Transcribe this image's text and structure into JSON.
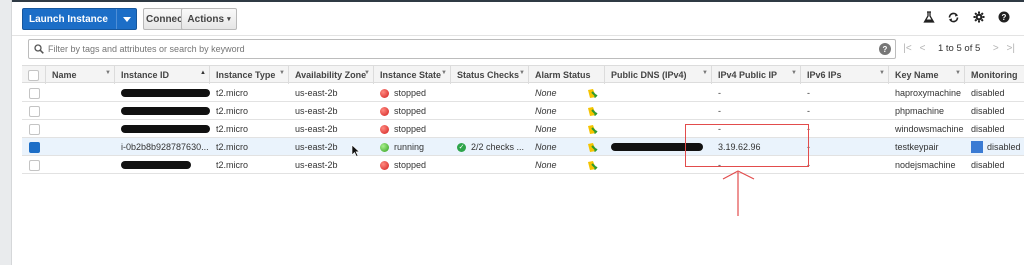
{
  "toolbar": {
    "launch_label": "Launch Instance",
    "connect_label": "Connect",
    "actions_label": "Actions",
    "icons": [
      "flask-icon",
      "refresh-icon",
      "gear-icon",
      "help-icon"
    ]
  },
  "search": {
    "placeholder": "Filter by tags and attributes or search by keyword",
    "help": "?"
  },
  "pager": {
    "first": "|<",
    "prev": "<",
    "range": "1 to 5 of 5",
    "next": ">",
    "last": ">|"
  },
  "columns": [
    "Name",
    "Instance ID",
    "Instance Type",
    "Availability Zone",
    "Instance State",
    "Status Checks",
    "Alarm Status",
    "Public DNS (IPv4)",
    "IPv4 Public IP",
    "IPv6 IPs",
    "Key Name",
    "Monitoring"
  ],
  "rows": [
    {
      "instance_id": "",
      "type": "t2.micro",
      "az": "us-east-2b",
      "state": "stopped",
      "state_color": "#d21f1f",
      "status": "",
      "alarm": "None",
      "dns": "",
      "ipv4": "-",
      "ipv6": "-",
      "key": "haproxymachine",
      "monitoring": "disabled",
      "selected": false
    },
    {
      "instance_id": "",
      "type": "t2.micro",
      "az": "us-east-2b",
      "state": "stopped",
      "state_color": "#d21f1f",
      "status": "",
      "alarm": "None",
      "dns": "",
      "ipv4": "-",
      "ipv6": "-",
      "key": "phpmachine",
      "monitoring": "disabled",
      "selected": false
    },
    {
      "instance_id": "",
      "type": "t2.micro",
      "az": "us-east-2b",
      "state": "stopped",
      "state_color": "#d21f1f",
      "status": "",
      "alarm": "None",
      "dns": "",
      "ipv4": "-",
      "ipv6": "-",
      "key": "windowsmachine",
      "monitoring": "disabled",
      "selected": false
    },
    {
      "instance_id": "i-0b2b8b928787630...",
      "type": "t2.micro",
      "az": "us-east-2b",
      "state": "running",
      "state_color": "#2f9e1d",
      "status": "2/2 checks ...",
      "alarm": "None",
      "dns": "",
      "ipv4": "3.19.62.96",
      "ipv6": "-",
      "key": "testkeypair",
      "monitoring": "disabled",
      "selected": true
    },
    {
      "instance_id": "",
      "type": "t2.micro",
      "az": "us-east-2b",
      "state": "stopped",
      "state_color": "#d21f1f",
      "status": "",
      "alarm": "None",
      "dns": "",
      "ipv4": "-",
      "ipv6": "-",
      "key": "nodejsmachine",
      "monitoring": "disabled",
      "selected": false
    }
  ],
  "colors": {
    "accent": "#1c6ec7",
    "annotation": "#e24c4c"
  }
}
